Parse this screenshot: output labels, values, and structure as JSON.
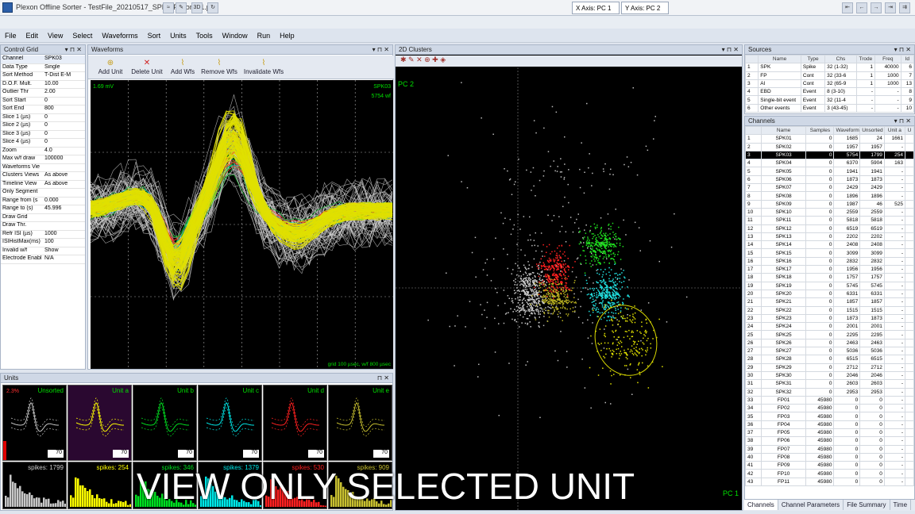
{
  "window": {
    "title": "Plexon Offline Sorter - TestFile_20210517_SPK-FP_sort-01.pl2"
  },
  "axes": {
    "x_label": "X Axis: PC 1",
    "y_label": "Y Axis: PC 2"
  },
  "menu": [
    "File",
    "Edit",
    "View",
    "Select",
    "Waveforms",
    "Sort",
    "Units",
    "Tools",
    "Window",
    "Run",
    "Help"
  ],
  "control_grid": {
    "title": "Control Grid",
    "rows": [
      [
        "Channel",
        "SPK03"
      ],
      [
        "Data Type",
        "Single"
      ],
      [
        "Sort Method",
        "T-Dist E-M"
      ],
      [
        "D.O.F. Mult.",
        "10.00"
      ],
      [
        "Outlier Thr",
        "2.00"
      ],
      [
        "Sort Start",
        "0"
      ],
      [
        "Sort End",
        "800"
      ],
      [
        "Slice 1 (µs)",
        "0"
      ],
      [
        "Slice 2 (µs)",
        "0"
      ],
      [
        "Slice 3 (µs)",
        "0"
      ],
      [
        "Slice 4 (µs)",
        "0"
      ],
      [
        "Zoom",
        "4.0"
      ],
      [
        "Max w/f draw",
        "100000"
      ],
      [
        "Waveforms Vie",
        ""
      ],
      [
        "Clusters Views",
        "As above"
      ],
      [
        "Timeline View",
        "As above"
      ],
      [
        "Only Segment",
        ""
      ],
      [
        "Range from (s",
        "0.000"
      ],
      [
        "Range to (s)",
        "45.996"
      ],
      [
        "Draw Grid",
        ""
      ],
      [
        "Draw Thr.",
        ""
      ],
      [
        "Refr ISI (µs)",
        "1000"
      ],
      [
        "ISIHistMax(ms)",
        "100"
      ],
      [
        "Invalid w/f",
        "Show"
      ],
      [
        "Electrode Enabl",
        "N/A"
      ]
    ]
  },
  "waveforms": {
    "title": "Waveforms",
    "buttons": [
      "Add Unit",
      "Delete Unit",
      "Add Wfs",
      "Remove Wfs",
      "Invalidate Wfs"
    ],
    "scale": "1.69 mV",
    "channel": "SPK03",
    "count": "5754 wf",
    "footer": "grid 100 µsec, w/f 800 µsec"
  },
  "clusters": {
    "title": "2D Clusters",
    "pc_y": "PC 2",
    "pc_x": "PC 1"
  },
  "sources": {
    "title": "Sources",
    "headers": [
      "",
      "Name",
      "Type",
      "Chs",
      "Trode",
      "Freq",
      "Id"
    ],
    "rows": [
      [
        "1",
        "SPK",
        "Spike",
        "32 (1-32)",
        "1",
        "40000",
        "6"
      ],
      [
        "2",
        "FP",
        "Cont",
        "32 (33-6",
        "1",
        "1000",
        "7"
      ],
      [
        "3",
        "AI",
        "Cont",
        "32 (65-9",
        "1",
        "1000",
        "13"
      ],
      [
        "4",
        "EBD",
        "Event",
        "8 (3-10)",
        "-",
        "-",
        "8"
      ],
      [
        "5",
        "Single-bit event",
        "Event",
        "32 (11-4",
        "-",
        "-",
        "9"
      ],
      [
        "6",
        "Other events",
        "Event",
        "3 (43-45)",
        "-",
        "-",
        "10"
      ]
    ]
  },
  "channels": {
    "title": "Channels",
    "headers": [
      "",
      "Name",
      "Samples",
      "Waveform",
      "Unsorted",
      "Unit a",
      "U"
    ],
    "rows": [
      [
        "1",
        "SPK01",
        "0",
        "1685",
        "24",
        "1661"
      ],
      [
        "2",
        "SPK02",
        "0",
        "1957",
        "1957",
        "-"
      ],
      [
        "3",
        "SPK03",
        "0",
        "5754",
        "1799",
        "254"
      ],
      [
        "4",
        "SPK04",
        "0",
        "6370",
        "5904",
        "163"
      ],
      [
        "5",
        "SPK05",
        "0",
        "1941",
        "1941",
        "-"
      ],
      [
        "6",
        "SPK06",
        "0",
        "1873",
        "1873",
        "-"
      ],
      [
        "7",
        "SPK07",
        "0",
        "2429",
        "2429",
        "-"
      ],
      [
        "8",
        "SPK08",
        "0",
        "1896",
        "1896",
        "-"
      ],
      [
        "9",
        "SPK09",
        "0",
        "1987",
        "46",
        "525"
      ],
      [
        "10",
        "SPK10",
        "0",
        "2559",
        "2559",
        "-"
      ],
      [
        "11",
        "SPK11",
        "0",
        "5818",
        "5818",
        "-"
      ],
      [
        "12",
        "SPK12",
        "0",
        "6519",
        "6519",
        "-"
      ],
      [
        "13",
        "SPK13",
        "0",
        "2202",
        "2202",
        "-"
      ],
      [
        "14",
        "SPK14",
        "0",
        "2408",
        "2408",
        "-"
      ],
      [
        "15",
        "SPK15",
        "0",
        "3099",
        "3099",
        "-"
      ],
      [
        "16",
        "SPK16",
        "0",
        "2832",
        "2832",
        "-"
      ],
      [
        "17",
        "SPK17",
        "0",
        "1956",
        "1956",
        "-"
      ],
      [
        "18",
        "SPK18",
        "0",
        "1757",
        "1757",
        "-"
      ],
      [
        "19",
        "SPK19",
        "0",
        "5745",
        "5745",
        "-"
      ],
      [
        "20",
        "SPK20",
        "0",
        "6331",
        "6331",
        "-"
      ],
      [
        "21",
        "SPK21",
        "0",
        "1857",
        "1857",
        "-"
      ],
      [
        "22",
        "SPK22",
        "0",
        "1515",
        "1515",
        "-"
      ],
      [
        "23",
        "SPK23",
        "0",
        "1873",
        "1873",
        "-"
      ],
      [
        "24",
        "SPK24",
        "0",
        "2001",
        "2001",
        "-"
      ],
      [
        "25",
        "SPK25",
        "0",
        "2295",
        "2295",
        "-"
      ],
      [
        "26",
        "SPK26",
        "0",
        "2463",
        "2463",
        "-"
      ],
      [
        "27",
        "SPK27",
        "0",
        "5036",
        "5036",
        "-"
      ],
      [
        "28",
        "SPK28",
        "0",
        "6515",
        "6515",
        "-"
      ],
      [
        "29",
        "SPK29",
        "0",
        "2712",
        "2712",
        "-"
      ],
      [
        "30",
        "SPK30",
        "0",
        "2046",
        "2046",
        "-"
      ],
      [
        "31",
        "SPK31",
        "0",
        "2603",
        "2603",
        "-"
      ],
      [
        "32",
        "SPK32",
        "0",
        "2953",
        "2953",
        "-"
      ],
      [
        "33",
        "FP01",
        "45980",
        "0",
        "0",
        "-"
      ],
      [
        "34",
        "FP02",
        "45980",
        "0",
        "0",
        "-"
      ],
      [
        "35",
        "FP03",
        "45980",
        "0",
        "0",
        "-"
      ],
      [
        "36",
        "FP04",
        "45980",
        "0",
        "0",
        "-"
      ],
      [
        "37",
        "FP05",
        "45980",
        "0",
        "0",
        "-"
      ],
      [
        "38",
        "FP06",
        "45980",
        "0",
        "0",
        "-"
      ],
      [
        "39",
        "FP07",
        "45980",
        "0",
        "0",
        "-"
      ],
      [
        "40",
        "FP08",
        "45980",
        "0",
        "0",
        "-"
      ],
      [
        "41",
        "FP09",
        "45980",
        "0",
        "0",
        "-"
      ],
      [
        "42",
        "FP10",
        "45980",
        "0",
        "0",
        "-"
      ],
      [
        "43",
        "FP11",
        "45980",
        "0",
        "0",
        "-"
      ]
    ],
    "selected_index": 2
  },
  "tabs": [
    "Channels",
    "Channel Parameters",
    "File Summary",
    "Time"
  ],
  "units": {
    "title": "Units",
    "pct": "2.3%",
    "cells": [
      "Unsorted",
      "Unit a",
      "Unit b",
      "Unit c",
      "Unit d",
      "Unit e"
    ],
    "spin": "70",
    "spikes": [
      "spikes: 1799",
      "spikes: 254",
      "spikes: 346",
      "spikes: 1379",
      "spikes: 530",
      "spikes: 909"
    ]
  },
  "caption": "VIEW ONLY SELECTED UNIT",
  "colors": {
    "unsorted": "#c8c8c8",
    "a": "#ffff00",
    "b": "#00e020",
    "c": "#00e8e8",
    "d": "#ff2020",
    "e": "#c8c030"
  }
}
